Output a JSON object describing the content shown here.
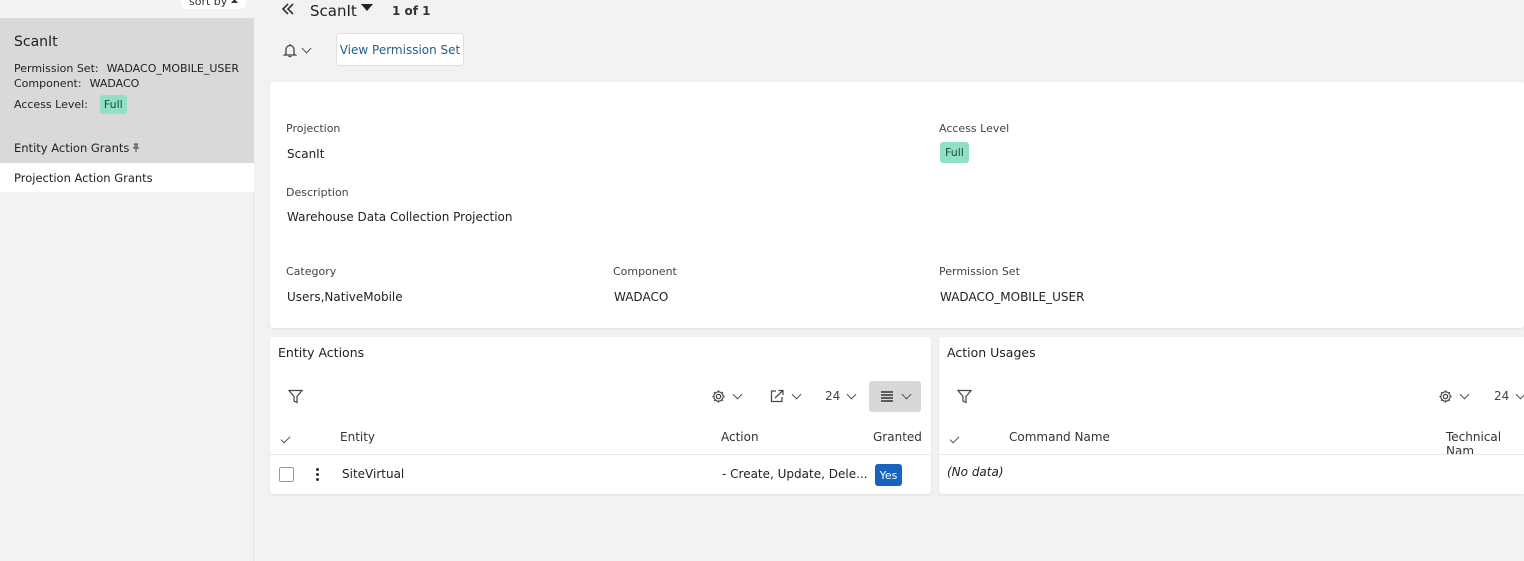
{
  "sidebar": {
    "sort_label": "sort by",
    "card": {
      "title": "ScanIt",
      "permission_set_key": "Permission Set:",
      "permission_set_value": "WADACO_MOBILE_USER",
      "component_key": "Component:",
      "component_value": "WADACO",
      "access_level_key": "Access Level:",
      "access_level_value": "Full"
    },
    "nav": {
      "entity_action_grants": "Entity Action Grants",
      "projection_action_grants": "Projection Action Grants"
    }
  },
  "header": {
    "title": "ScanIt",
    "record_count": "1 of 1",
    "view_permission_set": "View Permission Set"
  },
  "detail": {
    "projection_label": "Projection",
    "projection_value": "ScanIt",
    "access_level_label": "Access Level",
    "access_level_value": "Full",
    "description_label": "Description",
    "description_value": "Warehouse Data Collection Projection",
    "category_label": "Category",
    "category_value": "Users,NativeMobile",
    "component_label": "Component",
    "component_value": "WADACO",
    "permission_set_label": "Permission Set",
    "permission_set_value": "WADACO_MOBILE_USER"
  },
  "entity_actions": {
    "title": "Entity Actions",
    "page_size": "24",
    "columns": [
      "Entity",
      "Action",
      "Granted"
    ],
    "rows": [
      {
        "entity": "SiteVirtual",
        "action": "- Create, Update, Dele...",
        "granted": "Yes"
      }
    ]
  },
  "action_usages": {
    "title": "Action Usages",
    "page_size": "24",
    "columns": [
      "Command Name",
      "Technical Nam"
    ],
    "empty_text": "(No data)"
  },
  "colors": {
    "badge_full_bg": "#8fe0c6",
    "granted_yes_bg": "#1565c0",
    "link_blue": "#1f5f8a"
  }
}
